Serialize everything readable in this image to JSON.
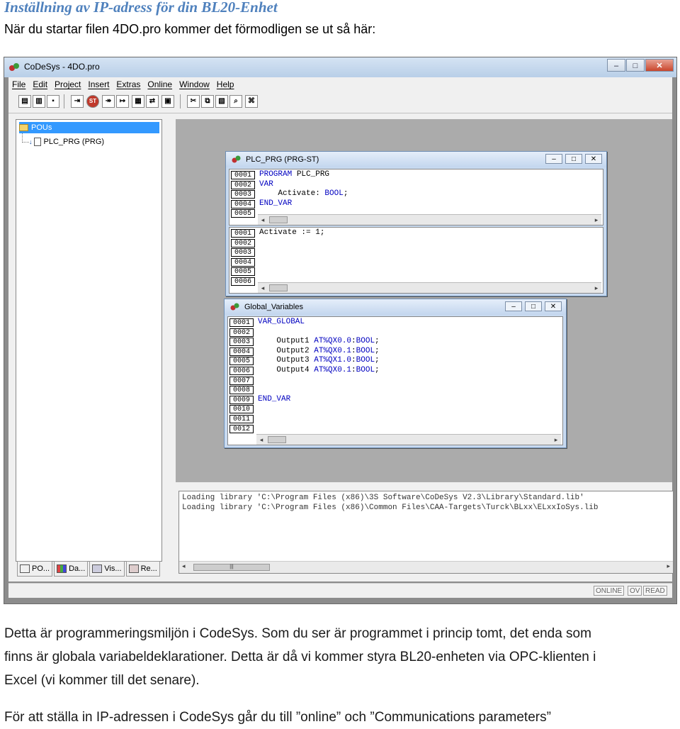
{
  "doc": {
    "heading": "Inställning av IP-adress för din BL20-Enhet",
    "intro": "När du startar filen 4DO.pro kommer det förmodligen se ut så här:",
    "para1_lines": [
      "Detta är programmeringsmiljön i CodeSys. Som du ser är programmet i princip tomt, det enda som",
      "finns är globala variabeldeklarationer. Detta är då vi kommer styra BL20-enheten via OPC-klienten i",
      "Excel (vi kommer till det senare)."
    ],
    "para2": "För att ställa in IP-adressen i CodeSys går du till ”online” och ”Communications parameters”"
  },
  "app": {
    "title": "CoDeSys - 4DO.pro",
    "window_buttons": {
      "minimize": "–",
      "maximize": "□",
      "close": "✕"
    },
    "menu": [
      "File",
      "Edit",
      "Project",
      "Insert",
      "Extras",
      "Online",
      "Window",
      "Help"
    ],
    "toolbar_icons": [
      "new-icon",
      "open-icon",
      "save-icon",
      "login-icon",
      "stop-icon",
      "run-icon",
      "step-icon",
      "cut-icon",
      "copy-icon",
      "paste-icon",
      "find-icon"
    ],
    "tree": {
      "root": "POUs",
      "child": "PLC_PRG (PRG)"
    },
    "tabs": [
      "PO...",
      "Da...",
      "Vis...",
      "Re..."
    ],
    "plc_window": {
      "title": "PLC_PRG (PRG-ST)",
      "decl_line_numbers": [
        "0001",
        "0002",
        "0003",
        "0004",
        "0005"
      ],
      "decl_lines": [
        "PROGRAM PLC_PRG",
        "VAR",
        "    Activate: BOOL;",
        "END_VAR",
        ""
      ],
      "body_line_numbers": [
        "0001",
        "0002",
        "0003",
        "0004",
        "0005",
        "0006"
      ],
      "body_lines": [
        "Activate := 1;",
        "",
        "",
        "",
        "",
        ""
      ]
    },
    "global_window": {
      "title": "Global_Variables",
      "line_numbers": [
        "0001",
        "0002",
        "0003",
        "0004",
        "0005",
        "0006",
        "0007",
        "0008",
        "0009",
        "0010",
        "0011",
        "0012"
      ],
      "lines": [
        "VAR_GLOBAL",
        "",
        "    Output1 AT%QX0.0:BOOL;",
        "    Output2 AT%QX0.1:BOOL;",
        "    Output3 AT%QX1.0:BOOL;",
        "    Output4 AT%QX0.1:BOOL;",
        "",
        "",
        "END_VAR",
        "",
        "",
        ""
      ]
    },
    "messages": [
      "Loading library 'C:\\Program Files (x86)\\3S Software\\CoDeSys V2.3\\Library\\Standard.lib'",
      "Loading library 'C:\\Program Files (x86)\\Common Files\\CAA-Targets\\Turck\\BLxx\\ELxxIoSys.lib"
    ],
    "status": {
      "online": "ONLINE",
      "ov": "OV",
      "read": "READ"
    }
  }
}
